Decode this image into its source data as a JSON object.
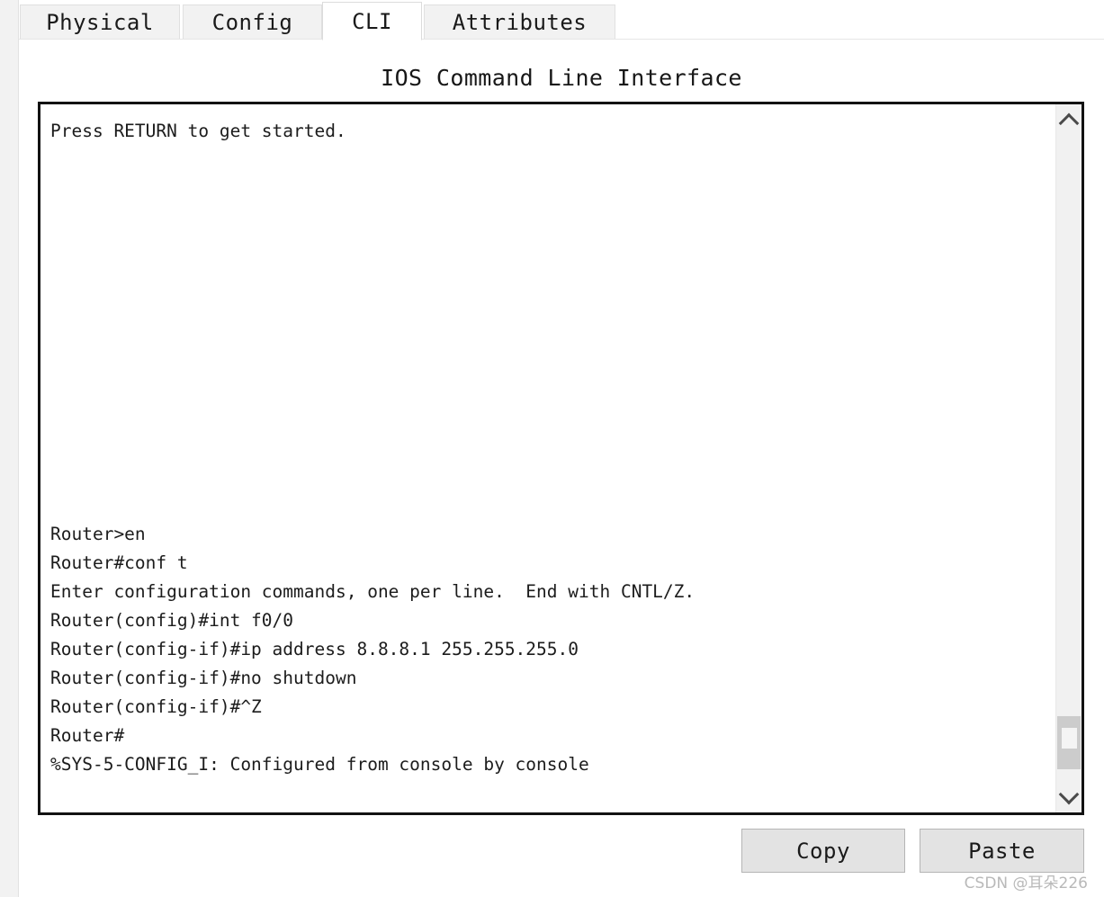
{
  "window": {
    "title": "IOS Command Line Interface"
  },
  "tabs": [
    {
      "id": "physical",
      "label": "Physical",
      "active": false
    },
    {
      "id": "config",
      "label": "Config",
      "active": false
    },
    {
      "id": "cli",
      "label": "CLI",
      "active": true
    },
    {
      "id": "attributes",
      "label": "Attributes",
      "active": false
    }
  ],
  "terminal": {
    "lines": [
      "Press RETURN to get started.",
      "",
      "",
      "",
      "",
      "",
      "",
      "",
      "",
      "",
      "",
      "",
      "",
      "",
      "Router>en",
      "Router#conf t",
      "Enter configuration commands, one per line.  End with CNTL/Z.",
      "Router(config)#int f0/0",
      "Router(config-if)#ip address 8.8.8.1 255.255.255.0",
      "Router(config-if)#no shutdown",
      "Router(config-if)#^Z",
      "Router#",
      "%SYS-5-CONFIG_I: Configured from console by console"
    ]
  },
  "scrollbar": {
    "up_arrow_icon": "chevron-up-icon",
    "down_arrow_icon": "chevron-down-icon"
  },
  "buttons": {
    "copy_label": "Copy",
    "paste_label": "Paste"
  },
  "watermark": {
    "text": "CSDN @耳朵226"
  },
  "colors": {
    "window_background": "#ffffff",
    "tab_inactive_background": "#f2f2f2",
    "tab_active_background": "#ffffff",
    "terminal_border": "#121212",
    "terminal_text": "#1c1c1c",
    "button_background": "#e3e3e3",
    "scrollbar_track": "#f1f1f1",
    "scrollbar_thumb": "#cccccc",
    "watermark_text": "#b9b9b9"
  }
}
